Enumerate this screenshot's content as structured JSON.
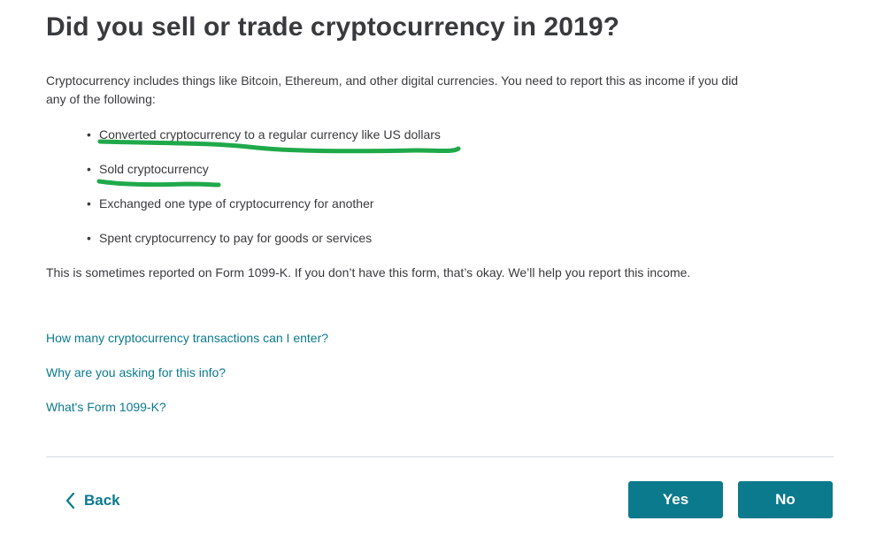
{
  "page": {
    "title": "Did you sell or trade cryptocurrency in 2019?",
    "intro": "Cryptocurrency includes things like Bitcoin, Ethereum, and other digital currencies. You need to report this as income if you did any of the following:",
    "bullets": [
      "Converted cryptocurrency to a regular currency like US dollars",
      "Sold cryptocurrency",
      "Exchanged one type of cryptocurrency for another",
      "Spent cryptocurrency to pay for goods or services"
    ],
    "note": "This is sometimes reported on Form 1099-K. If you don’t have this form, that’s okay. We’ll help you report this income."
  },
  "links": [
    "How many cryptocurrency transactions can I enter?",
    "Why are you asking for this info?",
    "What's Form 1099-K?"
  ],
  "footer": {
    "back_label": "Back",
    "yes_label": "Yes",
    "no_label": "No"
  },
  "colors": {
    "accent": "#0b7a8c",
    "link": "#0a7a8f",
    "text": "#393a3d",
    "highlight_marker": "#1fa94a"
  },
  "icons": {
    "back": "chevron-left-icon",
    "bullet": "bullet-dot-icon"
  }
}
